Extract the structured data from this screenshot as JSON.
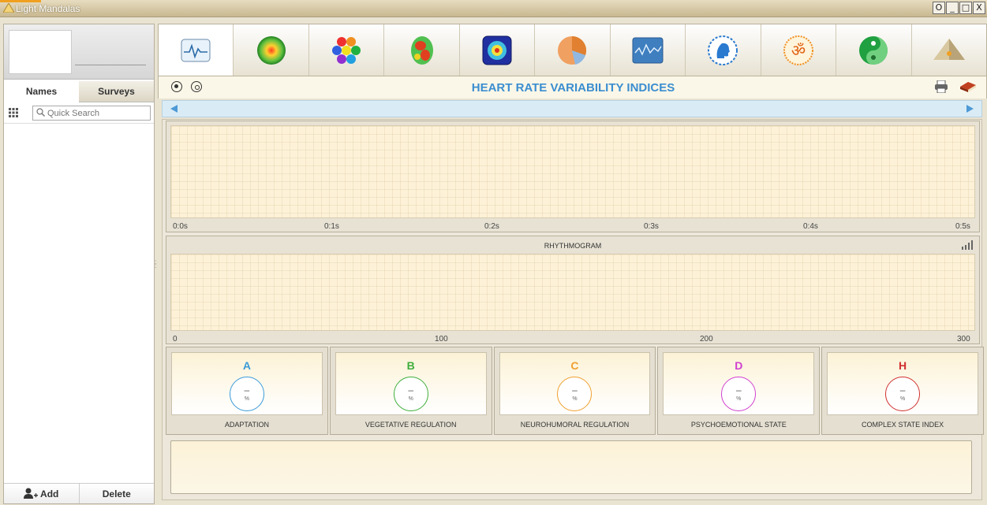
{
  "window": {
    "title": "Light Mandalas",
    "buttons": [
      "O",
      "_",
      "□",
      "X"
    ]
  },
  "sidebar": {
    "tabs": [
      {
        "label": "Names"
      },
      {
        "label": "Surveys"
      }
    ],
    "search_placeholder": "Quick Search",
    "add_label": "Add",
    "delete_label": "Delete"
  },
  "toolbar": {
    "icons": [
      "hrv-icon",
      "aura-orb-icon",
      "chakra-hexagons-icon",
      "body-heatmap-icon",
      "energy-field-icon",
      "pie-chart-icon",
      "spectrum-monitor-icon",
      "head-profile-icon",
      "om-symbol-icon",
      "yin-yang-icon",
      "pyramid-icon"
    ]
  },
  "header": {
    "title": "HEART RATE VARIABILITY INDICES"
  },
  "charts": {
    "top_ticks": [
      "0:0s",
      "0:1s",
      "0:2s",
      "0:3s",
      "0:4s",
      "0:5s"
    ],
    "rhythmogram_title": "RHYTHMOGRAM",
    "rhythmogram_ticks": [
      "0",
      "100",
      "200",
      "300"
    ]
  },
  "indices": [
    {
      "letter": "A",
      "value": "–",
      "unit": "%",
      "label": "ADAPTATION",
      "color": "#3a9ad9"
    },
    {
      "letter": "B",
      "value": "–",
      "unit": "%",
      "label": "VEGETATIVE REGULATION",
      "color": "#3fae3c"
    },
    {
      "letter": "C",
      "value": "–",
      "unit": "%",
      "label": "NEUROHUMORAL REGULATION",
      "color": "#f0a030"
    },
    {
      "letter": "D",
      "value": "–",
      "unit": "%",
      "label": "PSYCHOEMOTIONAL STATE",
      "color": "#d040d0"
    },
    {
      "letter": "H",
      "value": "–",
      "unit": "%",
      "label": "COMPLEX STATE INDEX",
      "color": "#d03030"
    }
  ],
  "chart_data": [
    {
      "type": "line",
      "title": "",
      "xlabel": "",
      "ylabel": "",
      "x_ticks": [
        "0:0s",
        "0:1s",
        "0:2s",
        "0:3s",
        "0:4s",
        "0:5s"
      ],
      "series": []
    },
    {
      "type": "line",
      "title": "RHYTHMOGRAM",
      "xlabel": "",
      "ylabel": "",
      "xlim": [
        0,
        300
      ],
      "x_ticks": [
        0,
        100,
        200,
        300
      ],
      "series": []
    }
  ]
}
